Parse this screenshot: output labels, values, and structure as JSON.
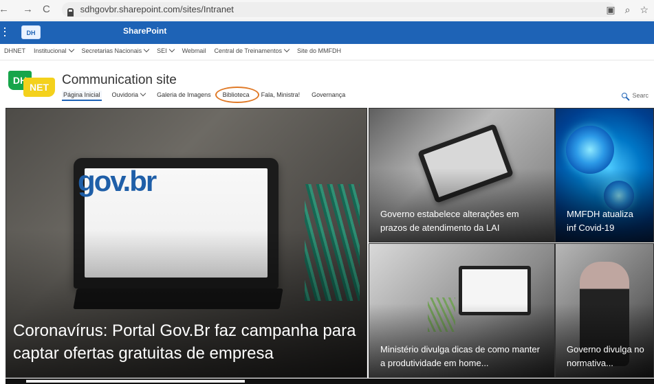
{
  "browser": {
    "url": "sdhgovbr.sharepoint.com/sites/Intranet"
  },
  "suitebar": {
    "logo_text": "DH NET",
    "title": "SharePoint"
  },
  "hub_nav": {
    "items": [
      "DHNET",
      "Institucional",
      "Secretarias Nacionais",
      "SEI",
      "Webmail",
      "Central de Treinamentos",
      "Site do MMFDH"
    ]
  },
  "site": {
    "logo_left": "DH",
    "logo_right": "NET",
    "title": "Communication site",
    "tabs": [
      "Página Inicial",
      "Ouvidoria",
      "Galeria de Imagens",
      "Biblioteca",
      "Fala, Ministra!",
      "Governança"
    ],
    "search_label": "Searc"
  },
  "hero": {
    "main_logo": "gov.br",
    "main_caption": "Coronavírus: Portal Gov.Br faz campanha para captar ofertas gratuitas de empresa",
    "tile_1_caption": "Governo estabelece alterações em prazos de atendimento da LAI",
    "tile_2_caption": "MMFDH atualiza inf Covid-19",
    "tile_3_caption": "Ministério divulga dicas de como manter a produtividade em home...",
    "tile_4_caption": "Governo divulga no normativa..."
  }
}
